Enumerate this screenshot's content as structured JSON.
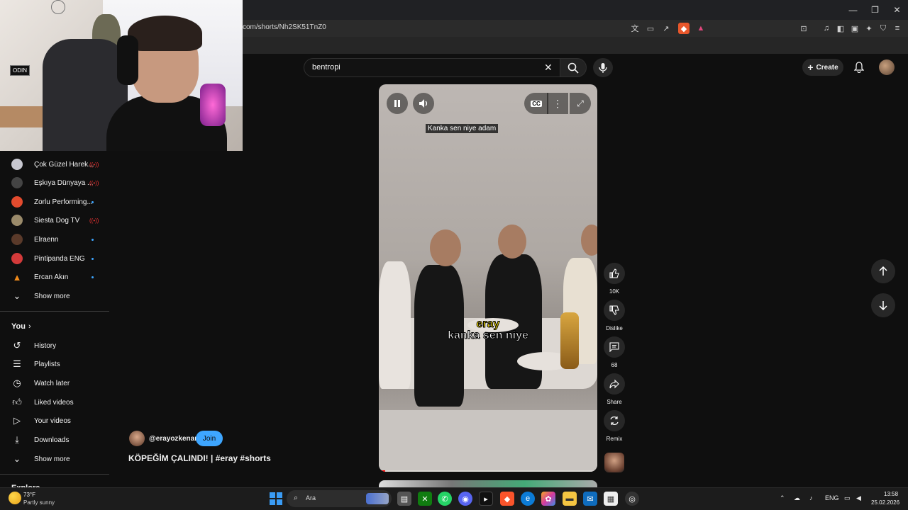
{
  "browser": {
    "url": "com/shorts/Nh2SK51TnZ0",
    "controls": {
      "minimize": "—",
      "restore": "❐",
      "close": "✕"
    }
  },
  "search": {
    "value": "bentropi"
  },
  "header": {
    "create_label": "Create"
  },
  "sidebar": {
    "subscriptions": [
      {
        "label": "Çok Güzel Harek...",
        "status": "live",
        "color": "#c8c8d0"
      },
      {
        "label": "Eşkıya Dünyaya ...",
        "status": "live",
        "color": "#444"
      },
      {
        "label": "Zorlu Performing...",
        "status": "new",
        "color": "#e34b2e"
      },
      {
        "label": "Siesta Dog TV",
        "status": "live",
        "color": "#9a8a6a"
      },
      {
        "label": "Elraenn",
        "status": "new",
        "color": "#5a3a2a"
      },
      {
        "label": "Pintipanda ENG",
        "status": "new",
        "color": "#d33a3a"
      },
      {
        "label": "Ercan Akın",
        "status": "new",
        "color": "#f08a1a"
      }
    ],
    "show_more_1": "Show more",
    "you_label": "You",
    "you_items": [
      {
        "label": "History",
        "icon": "history-icon"
      },
      {
        "label": "Playlists",
        "icon": "playlists-icon"
      },
      {
        "label": "Watch later",
        "icon": "watch-later-icon"
      },
      {
        "label": "Liked videos",
        "icon": "liked-icon"
      },
      {
        "label": "Your videos",
        "icon": "your-videos-icon"
      },
      {
        "label": "Downloads",
        "icon": "downloads-icon"
      }
    ],
    "show_more_2": "Show more",
    "explore_label": "Explore"
  },
  "video": {
    "top_caption": "Kanka sen niye adam",
    "caption_yellow": "eray",
    "caption_white": "kanka sen niye",
    "progress": 0.03
  },
  "actions": {
    "likes": "10K",
    "dislike_label": "Dislike",
    "comments": "68",
    "share_label": "Share",
    "remix_label": "Remix"
  },
  "channel": {
    "handle": "@erayozkenar",
    "join_label": "Join",
    "title": "KÖPEĞİM ÇALINDI! | #eray #shorts"
  },
  "taskbar": {
    "weather_temp": "73°F",
    "weather_desc": "Partly sunny",
    "search_label": "Ara",
    "lang": "ENG",
    "time": "13:58",
    "date": "25.02.2026"
  }
}
